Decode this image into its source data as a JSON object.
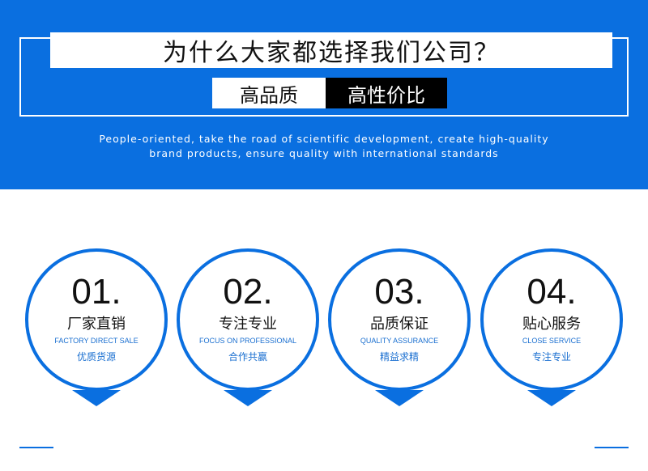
{
  "header": {
    "title": "为什么大家都选择我们公司？",
    "tag_left": "高品质",
    "tag_right": "高性价比",
    "tagline_line1": "People-oriented, take the road of scientific development, create high-quality",
    "tagline_line2": "brand products, ensure quality with international standards"
  },
  "colors": {
    "brand_blue": "#0a6fe0",
    "accent_text": "#1a6fd0"
  },
  "cards": [
    {
      "num": "01.",
      "cn": "厂家直销",
      "en": "FACTORY DIRECT SALE",
      "sub": "优质货源"
    },
    {
      "num": "02.",
      "cn": "专注专业",
      "en": "FOCUS ON PROFESSIONAL",
      "sub": "合作共赢"
    },
    {
      "num": "03.",
      "cn": "品质保证",
      "en": "QUALITY ASSURANCE",
      "sub": "精益求精"
    },
    {
      "num": "04.",
      "cn": "贴心服务",
      "en": "CLOSE SERVICE",
      "sub": "专注专业"
    }
  ]
}
